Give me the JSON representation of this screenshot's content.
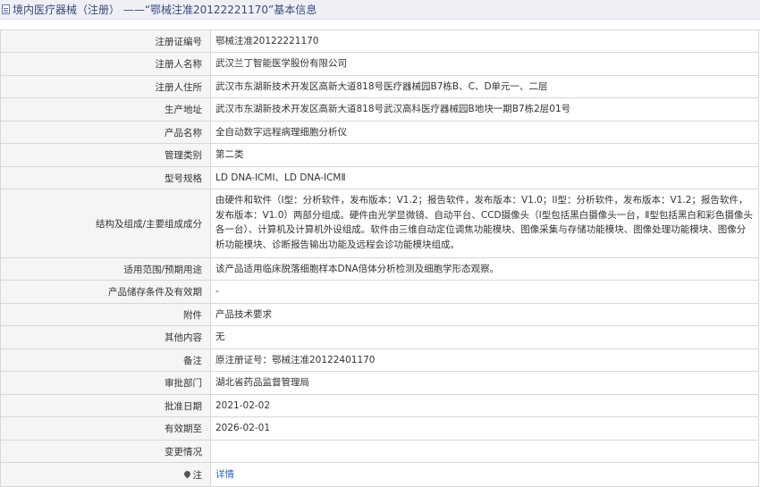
{
  "header": {
    "title": "境内医疗器械（注册） ——“鄂械注准20122221170”基本信息",
    "icon": "document-icon"
  },
  "rows": [
    {
      "label": "注册证编号",
      "value": "鄂械注准20122221170"
    },
    {
      "label": "注册人名称",
      "value": "武汉兰丁智能医学股份有限公司"
    },
    {
      "label": "注册人住所",
      "value": "武汉市东湖新技术开发区高新大道818号医疗器械园B7栋B、C、D单元一、二层"
    },
    {
      "label": "生产地址",
      "value": "武汉市东湖新技术开发区高新大道818号武汉高科医疗器械园B地块一期B7栋2层01号"
    },
    {
      "label": "产品名称",
      "value": "全自动数字远程病理细胞分析仪"
    },
    {
      "label": "管理类别",
      "value": "第二类"
    },
    {
      "label": "型号规格",
      "value": "LD DNA-ICMⅠ、LD DNA-ICMⅡ"
    },
    {
      "label": "结构及组成/主要组成成分",
      "value": "由硬件和软件（I型：分析软件，发布版本：V1.2；报告软件，发布版本：V1.0；II型：分析软件，发布版本：V1.2；报告软件，发布版本：V1.0）两部分组成。硬件由光学显微镜、自动平台、CCD摄像头（Ⅰ型包括黑白摄像头一台，Ⅱ型包括黑白和彩色摄像头各一台）、计算机及计算机外设组成。软件由三维自动定位调焦功能模块、图像采集与存储功能模块、图像处理功能模块、图像分析功能模块、诊断报告输出功能及远程会诊功能模块组成。"
    },
    {
      "label": "适用范围/预期用途",
      "value": "该产品适用临床脱落细胞样本DNA倍体分析检测及细胞学形态观察。"
    },
    {
      "label": "产品储存条件及有效期",
      "value": "-"
    },
    {
      "label": "附件",
      "value": "产品技术要求"
    },
    {
      "label": "其他内容",
      "value": "无"
    },
    {
      "label": "备注",
      "value": "原注册证号：鄂械注准20122401170"
    },
    {
      "label": "审批部门",
      "value": "湖北省药品监督管理局"
    },
    {
      "label": "批准日期",
      "value": "2021-02-02"
    },
    {
      "label": "有效期至",
      "value": "2026-02-01"
    },
    {
      "label": "变更情况",
      "value": ""
    },
    {
      "label": "注",
      "value": "详情",
      "icon": "pin-icon"
    }
  ]
}
